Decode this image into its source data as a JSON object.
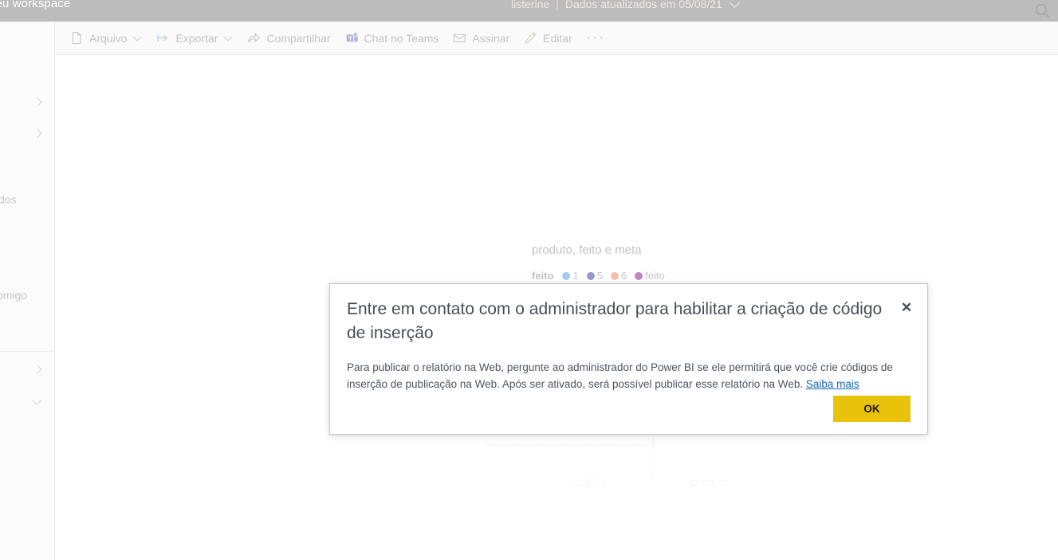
{
  "topbar": {
    "workspace": "Meu workspace",
    "report_name": "listerine",
    "separator": "|",
    "refresh_status": "Dados atualizados em 05/08/21",
    "chevron_icon": "chevron-down-icon",
    "search_icon": "search-icon"
  },
  "leftnav": {
    "items": [
      {
        "label": "",
        "icon": "chevron-right-icon",
        "has_chevron": true
      },
      {
        "label": "",
        "icon": "chevron-right-icon",
        "has_chevron": true
      },
      {
        "label": "dos",
        "icon": "",
        "has_chevron": false
      },
      {
        "label": "omigo",
        "icon": "",
        "has_chevron": false
      },
      {
        "label": "",
        "icon": "chevron-right-icon",
        "has_chevron": true
      },
      {
        "label": "",
        "icon": "chevron-down-icon",
        "has_chevron": true
      }
    ]
  },
  "toolbar": {
    "items": [
      {
        "label": "Arquivo",
        "icon": "file-icon",
        "has_dropdown": true
      },
      {
        "label": "Exportar",
        "icon": "export-icon",
        "has_dropdown": true
      },
      {
        "label": "Compartilhar",
        "icon": "share-icon",
        "has_dropdown": false
      },
      {
        "label": "Chat no Teams",
        "icon": "teams-icon",
        "has_dropdown": false
      },
      {
        "label": "Assinar",
        "icon": "mail-icon",
        "has_dropdown": false
      },
      {
        "label": "Editar",
        "icon": "pencil-icon",
        "has_dropdown": false
      }
    ],
    "more_label": "···"
  },
  "report": {
    "chart_title": "produto, feito e meta",
    "legend_group_label": "feito",
    "legend": [
      {
        "label": "1",
        "color": "#9dc8ea"
      },
      {
        "label": "5",
        "color": "#8f92c9"
      },
      {
        "label": "6",
        "color": "#f3bda0"
      },
      {
        "label": "feito",
        "color": "#c07ac4"
      }
    ],
    "axis_labels": [
      "produto",
      "produto"
    ]
  },
  "chart_data": {
    "type": "bar",
    "title": "produto, feito e meta",
    "xlabel": "produto",
    "ylabel": "",
    "legend_title": "feito",
    "categories": [
      "produto",
      "produto"
    ],
    "series": [
      {
        "name": "1",
        "color": "#9dc8ea",
        "values": [
          null,
          null
        ]
      },
      {
        "name": "5",
        "color": "#8f92c9",
        "values": [
          null,
          null
        ]
      },
      {
        "name": "6",
        "color": "#f3bda0",
        "values": [
          null,
          null
        ]
      },
      {
        "name": "feito",
        "color": "#c07ac4",
        "values": [
          null,
          null
        ]
      }
    ],
    "grid": true,
    "legend_position": "top"
  },
  "dialog": {
    "title": "Entre em contato com o administrador para habilitar a criação de código de inserção",
    "body_part1": "Para publicar o relatório na Web, pergunte ao administrador do Power BI se ele permitirá que você crie códigos de inserção de publicação na Web. Após ser ativado, será possível publicar esse relatório na Web. ",
    "link_label": "Saiba mais",
    "ok_label": "OK",
    "close_icon": "close-icon",
    "accent_color": "#e9c20c"
  }
}
